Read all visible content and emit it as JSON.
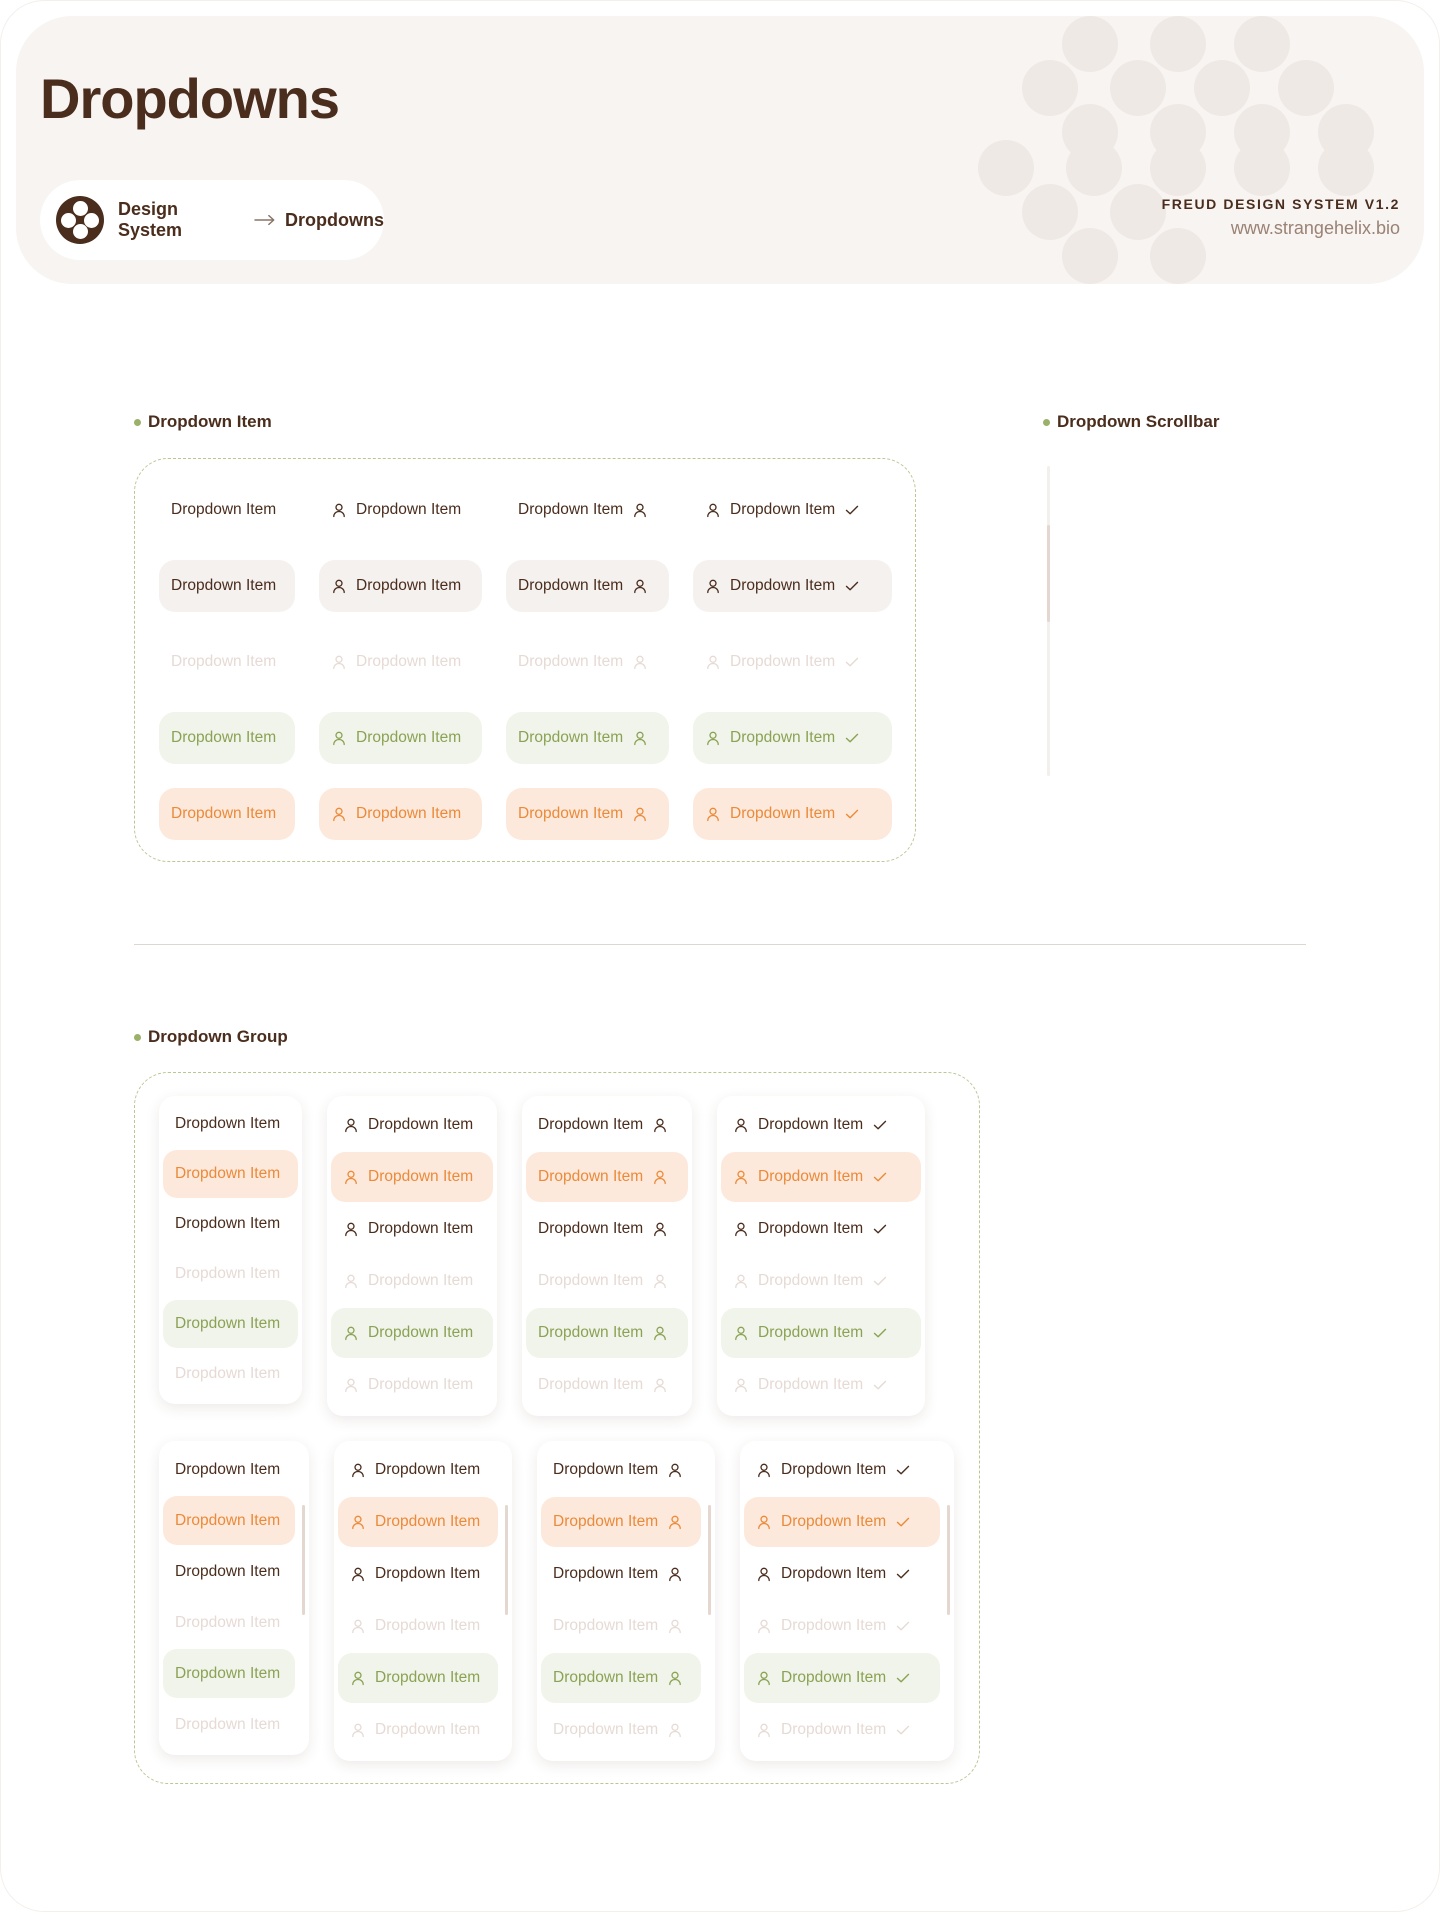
{
  "header": {
    "title": "Dropdowns",
    "breadcrumb": [
      "Design System",
      "Dropdowns"
    ],
    "brand_name": "FREUD DESIGN SYSTEM V1.2",
    "brand_url": "www.strangehelix.bio"
  },
  "sections": {
    "item": "Dropdown Item",
    "scrollbar": "Dropdown Scrollbar",
    "group": "Dropdown Group"
  },
  "item_label": "Dropdown Item",
  "colors": {
    "brown": "#4a2d1d",
    "green": "#8ba254",
    "orange": "#ea8a3a",
    "disabled": "#e6dad5",
    "header_bg": "#f7f4f2"
  },
  "variants": [
    {
      "left_icon": "",
      "right_icon": ""
    },
    {
      "left_icon": "user-icon",
      "right_icon": ""
    },
    {
      "left_icon": "",
      "right_icon": "user-icon"
    },
    {
      "left_icon": "user-icon",
      "right_icon": "check-icon"
    }
  ],
  "states": [
    "default",
    "hover",
    "disabled",
    "active",
    "selected"
  ],
  "group_states": [
    "default",
    "selected",
    "default",
    "disabled",
    "active",
    "disabled"
  ]
}
